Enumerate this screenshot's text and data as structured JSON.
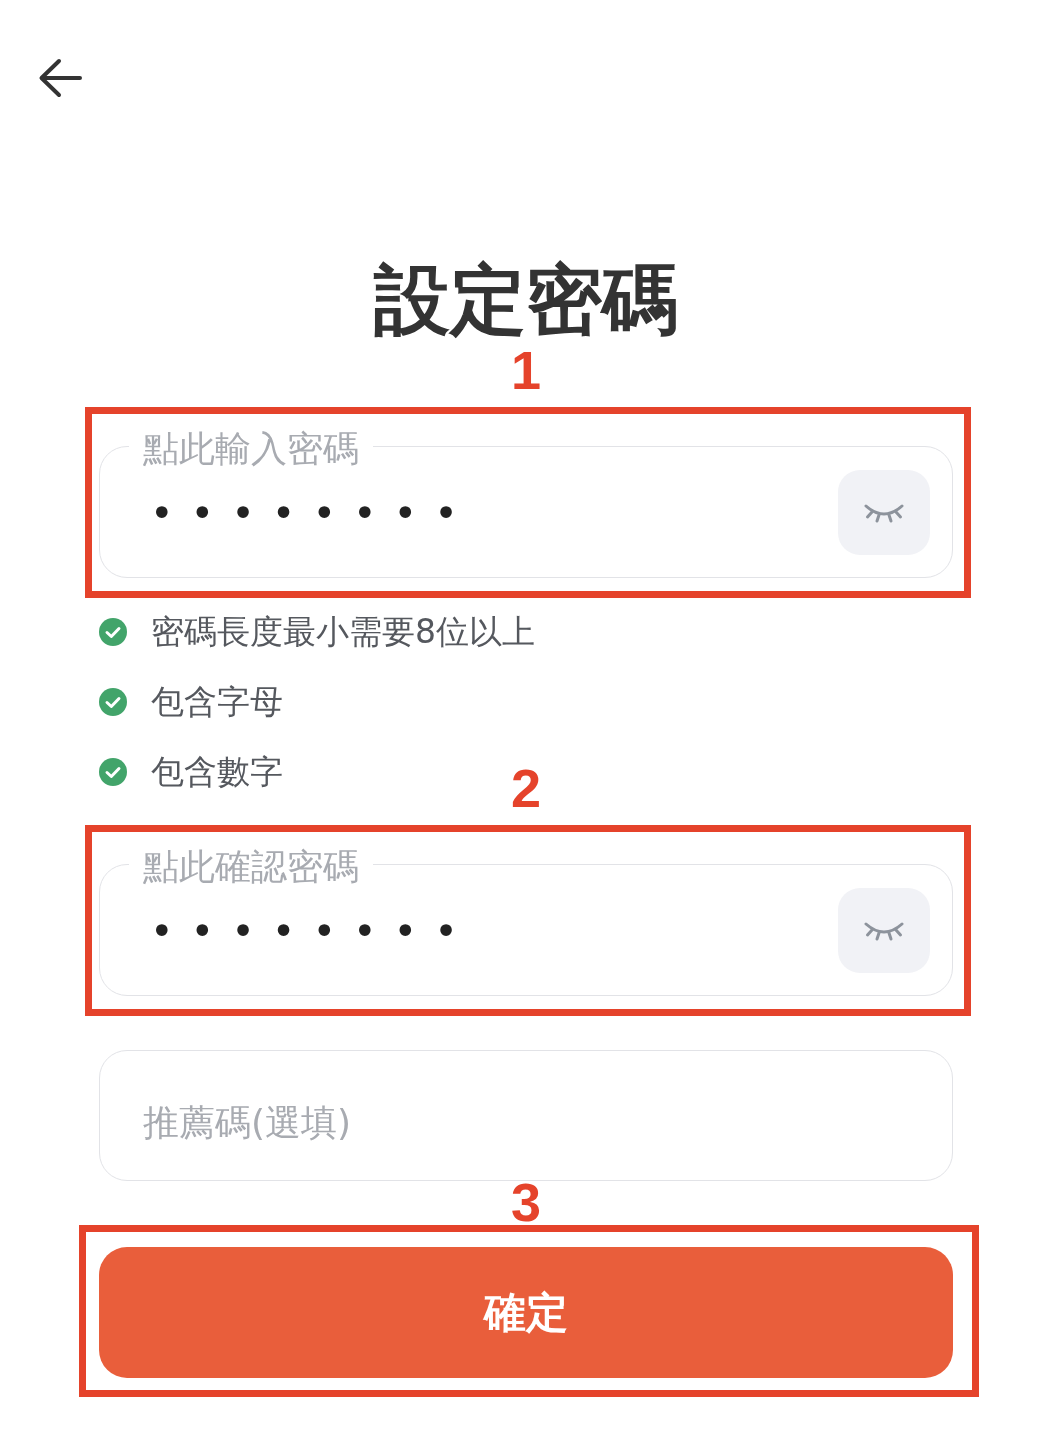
{
  "title": "設定密碼",
  "password_field": {
    "label": "點此輸入密碼",
    "value": "••••••••",
    "revealed": false,
    "annotation": "1"
  },
  "requirements": [
    {
      "text": "密碼長度最小需要8位以上",
      "met": true
    },
    {
      "text": "包含字母",
      "met": true
    },
    {
      "text": "包含數字",
      "met": true
    }
  ],
  "confirm_field": {
    "label": "點此確認密碼",
    "value": "••••••••",
    "revealed": false,
    "annotation": "2"
  },
  "referral_field": {
    "placeholder": "推薦碼(選填)"
  },
  "submit_button": {
    "label": "確定",
    "annotation": "3"
  }
}
